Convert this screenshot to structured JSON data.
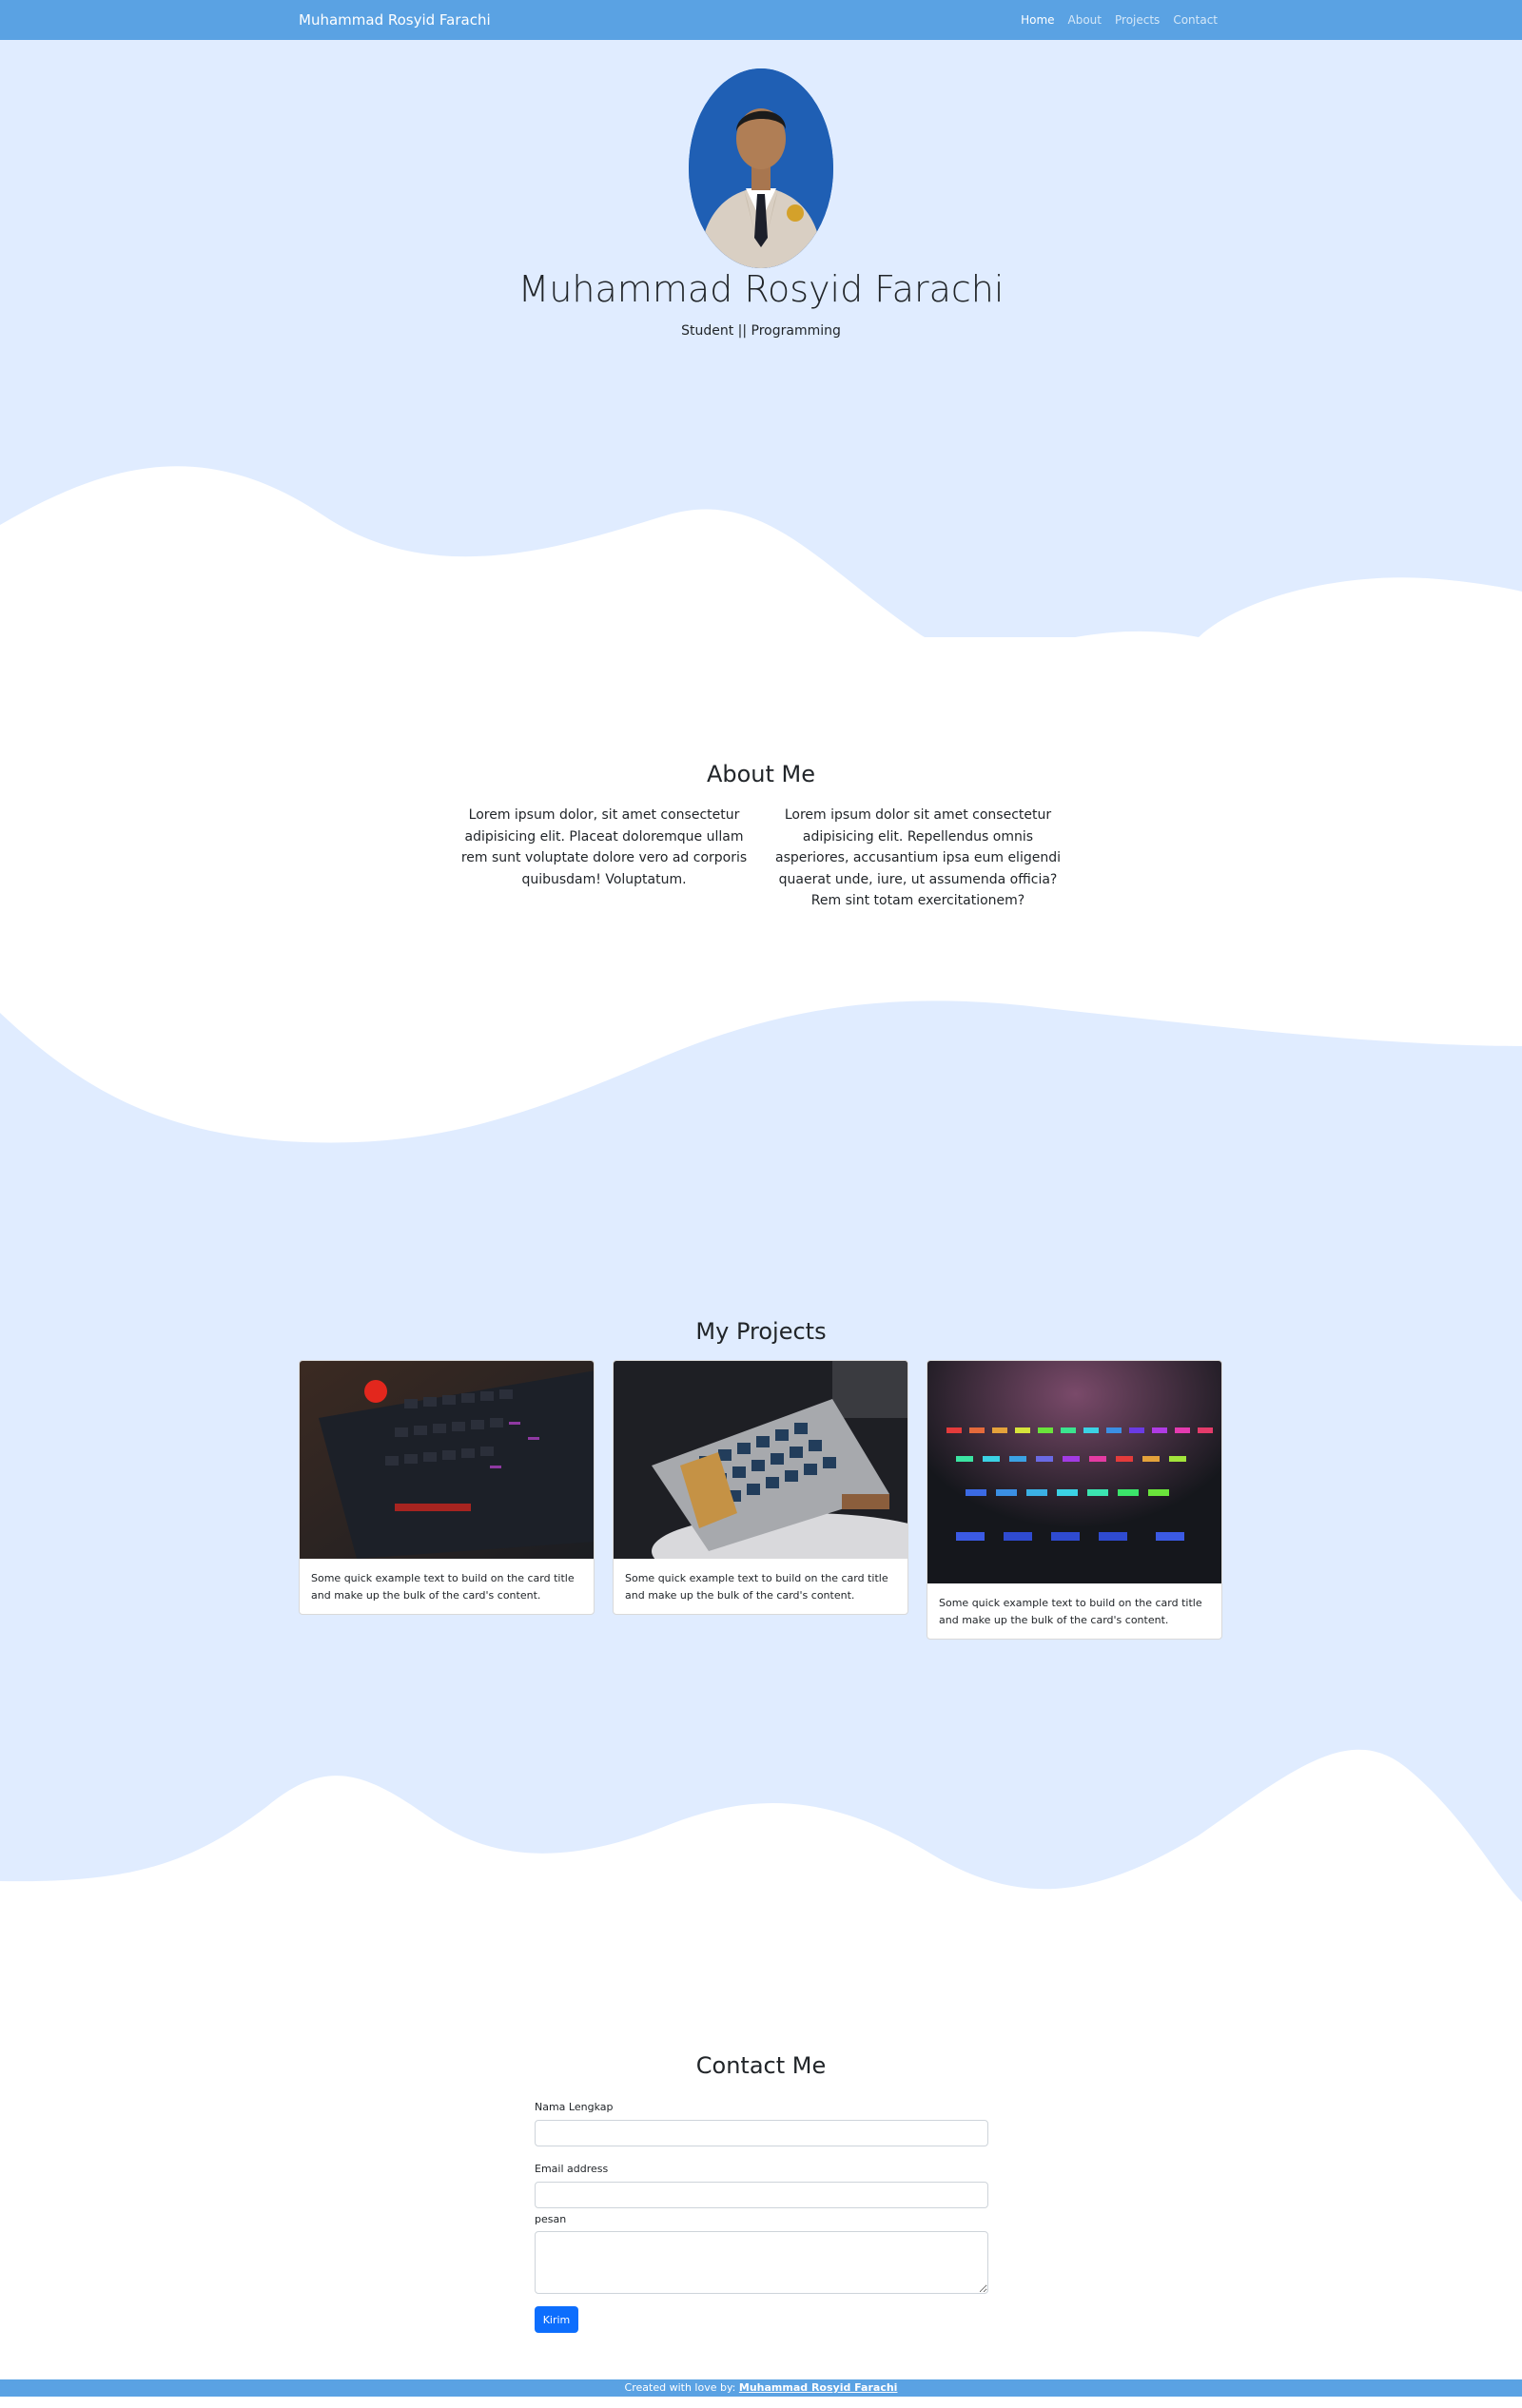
{
  "navbar": {
    "brand": "Muhammad Rosyid Farachi",
    "links": [
      {
        "label": "Home",
        "active": true
      },
      {
        "label": "About",
        "active": false
      },
      {
        "label": "Projects",
        "active": false
      },
      {
        "label": "Contact",
        "active": false
      }
    ]
  },
  "hero": {
    "name": "Muhammad Rosyid Farachi",
    "tagline": "Student || Programming"
  },
  "about": {
    "title": "About Me",
    "col1": "Lorem ipsum dolor, sit amet consectetur adipisicing elit. Placeat doloremque ullam rem sunt voluptate dolore vero ad corporis quibusdam! Voluptatum.",
    "col2": "Lorem ipsum dolor sit amet consectetur adipisicing elit. Repellendus omnis asperiores, accusantium ipsa eum eligendi quaerat unde, iure, ut assumenda officia? Rem sint totam exercitationem?"
  },
  "projects": {
    "title": "My Projects",
    "cards": [
      {
        "text": "Some quick example text to build on the card title and make up the bulk of the card's content."
      },
      {
        "text": "Some quick example text to build on the card title and make up the bulk of the card's content."
      },
      {
        "text": "Some quick example text to build on the card title and make up the bulk of the card's content."
      }
    ]
  },
  "contact": {
    "title": "Contact Me",
    "name_label": "Nama Lengkap",
    "email_label": "Email address",
    "message_label": "pesan",
    "submit_label": "Kirim"
  },
  "footer": {
    "prefix": "Created with love by: ",
    "author": "Muhammad Rosyid Farachi"
  },
  "colors": {
    "primary": "#5aa2e3",
    "light_bg": "#e0ecff",
    "button": "#0d6efd"
  }
}
